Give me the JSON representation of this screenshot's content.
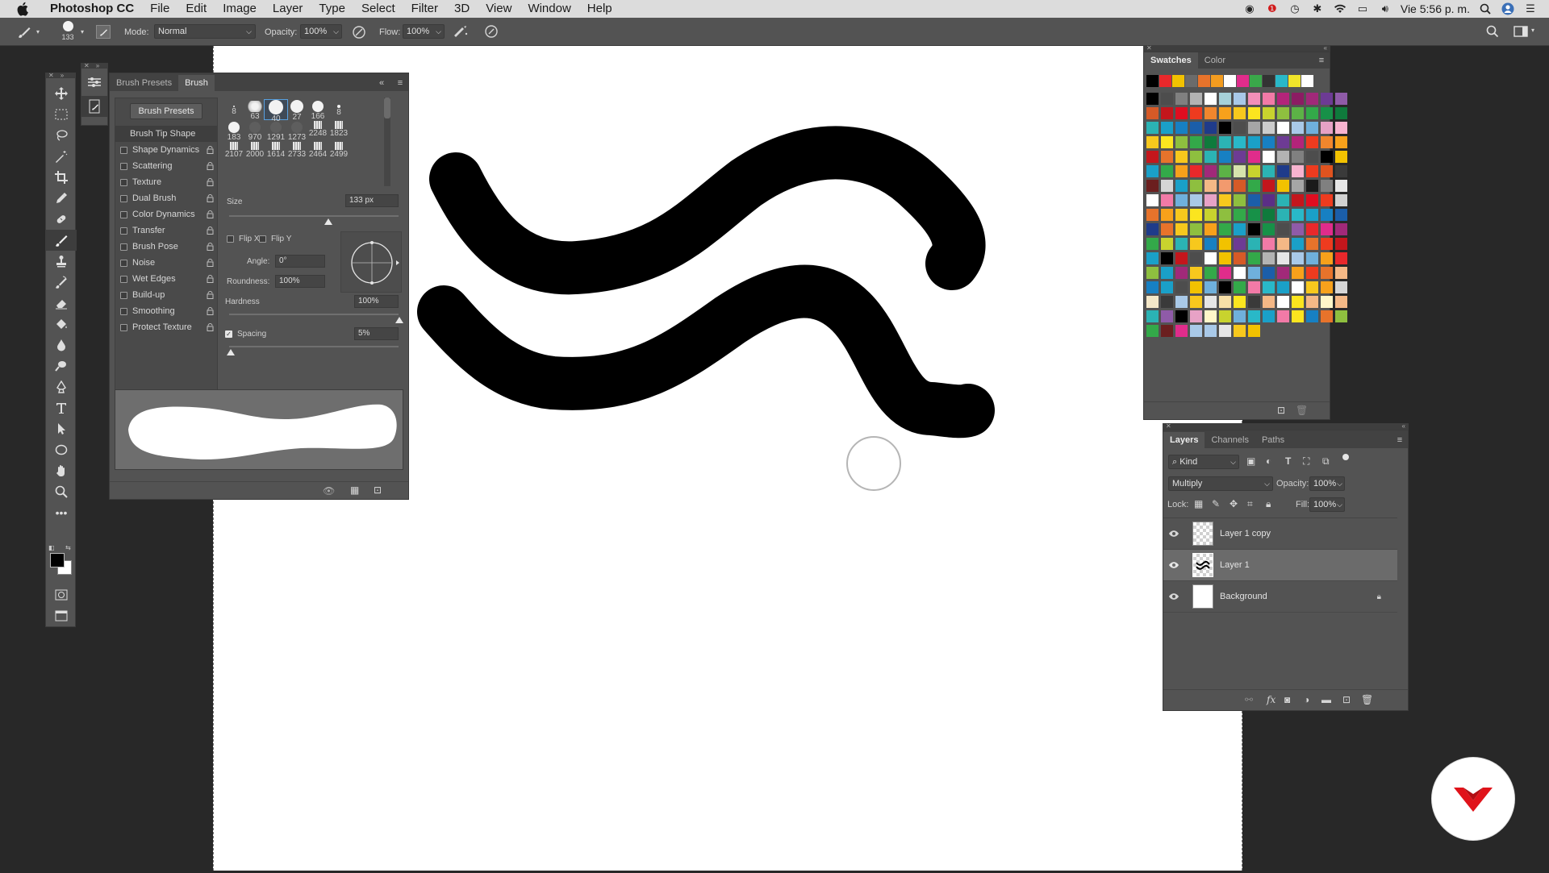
{
  "menubar": {
    "app_name": "Photoshop CC",
    "items": [
      "File",
      "Edit",
      "Image",
      "Layer",
      "Type",
      "Select",
      "Filter",
      "3D",
      "View",
      "Window",
      "Help"
    ],
    "clock": "Vie 5:56 p. m."
  },
  "options_bar": {
    "brush_size": "133",
    "mode_label": "Mode:",
    "mode_value": "Normal",
    "opacity_label": "Opacity:",
    "opacity_value": "100%",
    "flow_label": "Flow:",
    "flow_value": "100%"
  },
  "toolbar": {
    "tools": [
      "move-tool-icon",
      "marquee-tool-icon",
      "lasso-tool-icon",
      "magic-wand-icon",
      "crop-tool-icon",
      "eyedropper-icon",
      "healing-brush-icon",
      "brush-tool-icon",
      "clone-stamp-icon",
      "history-brush-icon",
      "eraser-icon",
      "paint-bucket-icon",
      "blur-tool-icon",
      "dodge-tool-icon",
      "pen-tool-icon",
      "type-tool-icon",
      "path-selection-icon",
      "ellipse-tool-icon",
      "hand-tool-icon",
      "zoom-tool-icon",
      "more-tools-icon"
    ]
  },
  "brush_panel": {
    "tabs": [
      "Brush Presets",
      "Brush"
    ],
    "active_tab": "Brush",
    "presets_button": "Brush Presets",
    "settings": [
      {
        "label": "Brush Tip Shape",
        "checkbox": false,
        "selected": true
      },
      {
        "label": "Shape Dynamics",
        "checkbox": true
      },
      {
        "label": "Scattering",
        "checkbox": true
      },
      {
        "label": "Texture",
        "checkbox": true
      },
      {
        "label": "Dual Brush",
        "checkbox": true
      },
      {
        "label": "Color Dynamics",
        "checkbox": true
      },
      {
        "label": "Transfer",
        "checkbox": true
      },
      {
        "label": "Brush Pose",
        "checkbox": true
      },
      {
        "label": "Noise",
        "checkbox": true
      },
      {
        "label": "Wet Edges",
        "checkbox": true
      },
      {
        "label": "Build-up",
        "checkbox": true
      },
      {
        "label": "Smoothing",
        "checkbox": true
      },
      {
        "label": "Protect Texture",
        "checkbox": true
      }
    ],
    "tip_sizes_row1": [
      "8",
      "63",
      "40",
      "27",
      "166",
      "8"
    ],
    "tip_sizes_row2": [
      "183",
      "970",
      "1291",
      "1273",
      "2248",
      "1823"
    ],
    "tip_sizes_row3": [
      "2107",
      "2000",
      "1614",
      "2733",
      "2464",
      "2499"
    ],
    "size_label": "Size",
    "size_value": "133 px",
    "flip_x": "Flip X",
    "flip_y": "Flip Y",
    "angle_label": "Angle:",
    "angle_value": "0°",
    "roundness_label": "Roundness:",
    "roundness_value": "100%",
    "hardness_label": "Hardness",
    "hardness_value": "100%",
    "spacing_label": "Spacing",
    "spacing_value": "5%",
    "spacing_checked": true
  },
  "swatches_panel": {
    "tabs": [
      "Swatches",
      "Color"
    ],
    "active_tab": "Swatches",
    "recent": [
      "#000000",
      "#e8282b",
      "#f2c200",
      "#6b6b6b",
      "#e7732b",
      "#f39c1f",
      "#ffffff",
      "#e02c8b",
      "#3aa84a",
      "#333333",
      "#29b8c8",
      "#f0e52a",
      "#ffffff"
    ],
    "colors": [
      "#000000",
      "#4d4d4d",
      "#808080",
      "#b3b3b3",
      "#ffffff",
      "#a6d1d9",
      "#a9c9e8",
      "#f28fb8",
      "#f27aa7",
      "#b3247a",
      "#8c1c63",
      "#a12979",
      "#6d3b94",
      "#8f5ba8",
      "#d65a27",
      "#c4161c",
      "#e00d20",
      "#ee3b1f",
      "#f1862d",
      "#f7a11b",
      "#f7c81d",
      "#fbe51f",
      "#c8d32e",
      "#8ebf3f",
      "#5cb246",
      "#33a949",
      "#179148",
      "#0f7a3c",
      "#2bb3b4",
      "#1aa0c8",
      "#1780c3",
      "#1b5ea9",
      "#1f3b8a",
      "#000000",
      "#4d4d4d",
      "#a6a6a6",
      "#cccccc",
      "#ffffff",
      "#a9c9e8",
      "#6fb0dc",
      "#e7a2c6",
      "#f7b3cf",
      "#f7c81d",
      "#fbe51f",
      "#8ebf3f",
      "#33a949",
      "#0f7a3c",
      "#2bb3b4",
      "#29b8c8",
      "#1aa0c8",
      "#1780c3",
      "#6d3b94",
      "#b3247a",
      "#ee3b1f",
      "#f1862d",
      "#f7a11b",
      "#c4161c",
      "#e7732b",
      "#f7c81d",
      "#8ebf3f",
      "#2bb3b4",
      "#1780c3",
      "#6d3b94",
      "#e02c8b",
      "#ffffff",
      "#b3b3b3",
      "#808080",
      "#4d4d4d",
      "#000000",
      "#f2c200",
      "#1aa0c8",
      "#33a949",
      "#f7a11b",
      "#e8282b",
      "#a12979",
      "#5cb246",
      "#d7e3ad",
      "#c8d32e",
      "#2bb3b4",
      "#1f3b8a",
      "#f7b3cf",
      "#ee3b1f",
      "#e0531f",
      "#3a3a3a",
      "#6b1f1f",
      "#d6d6d6",
      "#1aa0c8",
      "#8ebf3f",
      "#f4b886",
      "#f29a6e",
      "#d65a27",
      "#33a949",
      "#c4161c",
      "#f2c200",
      "#a6a6a6",
      "#1a1a1a",
      "#808080",
      "#e6e6e6",
      "#ffffff",
      "#f27aa7",
      "#6fb0dc",
      "#a9c9e8",
      "#e7a2c6",
      "#f7c81d",
      "#8ebf3f",
      "#1b5ea9",
      "#5b2e86",
      "#2bb3b4",
      "#c4161c",
      "#e00d20",
      "#ee3b1f",
      "#d1d1d1",
      "#e7732b",
      "#f7a11b",
      "#f7c81d",
      "#fbe51f",
      "#c8d32e",
      "#8ebf3f",
      "#33a949",
      "#179148",
      "#0f7a3c",
      "#2bb3b4",
      "#29b8c8",
      "#1aa0c8",
      "#1780c3",
      "#1b5ea9",
      "#1f3b8a",
      "#e7732b",
      "#f7c81d",
      "#8ebf3f",
      "#f7a11b",
      "#33a949",
      "#1aa0c8",
      "#000000",
      "#179148",
      "#4d4d4d",
      "#8f5ba8",
      "#e8282b",
      "#e02c8b",
      "#a12979",
      "#33a949",
      "#c8d32e",
      "#2bb3b4",
      "#f7c81d",
      "#1780c3",
      "#f2c200",
      "#6d3b94",
      "#2bb3b4",
      "#f27aa7",
      "#f4b886",
      "#1aa0c8",
      "#e7732b",
      "#ee3b1f",
      "#c4161c",
      "#1aa0c8",
      "#000000",
      "#c4161c",
      "#4d4d4d",
      "#ffffff",
      "#f2c200",
      "#d65a27",
      "#33a949",
      "#b3b3b3",
      "#e6e6e6",
      "#a9c9e8",
      "#6fb0dc",
      "#f7a11b",
      "#e8282b",
      "#8ebf3f",
      "#1aa0c8",
      "#a12979",
      "#f7c81d",
      "#33a949",
      "#e02c8b",
      "#ffffff",
      "#6fb0dc",
      "#1b5ea9",
      "#a12979",
      "#f7a11b",
      "#ee3b1f",
      "#e7732b",
      "#f4b886",
      "#1780c3",
      "#1aa0c8",
      "#4d4d4d",
      "#f2c200",
      "#6fb0dc",
      "#000000",
      "#33a949",
      "#f27aa7",
      "#29b8c8",
      "#1aa0c8",
      "#ffffff",
      "#f7c81d",
      "#f7a11b",
      "#d6d6d6",
      "#f4e7c8",
      "#3a3a3a",
      "#a9c9e8",
      "#f7c81d",
      "#e6e6e6",
      "#f7e0a8",
      "#fbe51f",
      "#3a3a3a",
      "#f4b886",
      "#ffffff",
      "#fbe51f",
      "#f4b886",
      "#fff6c8",
      "#f4b886",
      "#2bb3b4",
      "#8f5ba8",
      "#000000",
      "#e7a2c6",
      "#fff6c8",
      "#c8d32e",
      "#6fb0dc",
      "#29b8c8",
      "#1aa0c8",
      "#f27aa7",
      "#fbe51f",
      "#1780c3",
      "#e7732b",
      "#8ebf3f",
      "#33a949",
      "#6b1f1f",
      "#e02c8b",
      "#a9c9e8",
      "#a9c9e8",
      "#e6e6e6",
      "#f7c81d",
      "#f2c200"
    ]
  },
  "layers_panel": {
    "tabs": [
      "Layers",
      "Channels",
      "Paths"
    ],
    "active_tab": "Layers",
    "filter_value": "Kind",
    "blend_mode": "Multiply",
    "opacity_label": "Opacity:",
    "opacity_value": "100%",
    "lock_label": "Lock:",
    "fill_label": "Fill:",
    "fill_value": "100%",
    "layers": [
      {
        "name": "Layer 1 copy",
        "selected": false,
        "thumb": "transparent"
      },
      {
        "name": "Layer 1",
        "selected": true,
        "thumb": "stroke"
      },
      {
        "name": "Background",
        "selected": false,
        "thumb": "white",
        "locked": true
      }
    ]
  },
  "colors": {
    "canvas": "#ffffff",
    "foreground": "#000000",
    "background": "#ffffff",
    "badge_accent": "#e0131a"
  }
}
